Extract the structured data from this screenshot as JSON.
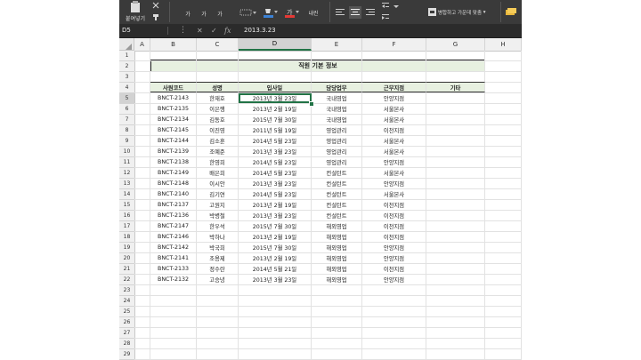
{
  "ribbon": {
    "paste_label": "붙여넣기",
    "font_bold": "가",
    "font_italic": "가",
    "font_underline": "가",
    "wrap_label": "내린",
    "merge_label": "병합하고 가운데 맞춤",
    "merge_arrow": "▾"
  },
  "formula_bar": {
    "cell_ref": "D5",
    "fx": "fx",
    "value": "2013.3.23"
  },
  "columns": [
    "A",
    "B",
    "C",
    "D",
    "E",
    "F",
    "G",
    "H"
  ],
  "rows": [
    "1",
    "2",
    "3",
    "4",
    "5",
    "6",
    "7",
    "8",
    "9",
    "10",
    "11",
    "12",
    "13",
    "14",
    "15",
    "16",
    "17",
    "18",
    "19",
    "20",
    "21",
    "22",
    "23",
    "24",
    "25",
    "26",
    "27",
    "28",
    "29"
  ],
  "sheet": {
    "title": "직원 기본 정보",
    "headers": [
      "사원코드",
      "성명",
      "입사일",
      "담당업무",
      "근무지점",
      "기타"
    ],
    "records": [
      [
        "BNCT-2143",
        "한재호",
        "2013년 3월 23일",
        "국내영업",
        "안양지점",
        ""
      ],
      [
        "BNCT-2135",
        "이은행",
        "2013년 2월 19일",
        "국내영업",
        "서울본사",
        ""
      ],
      [
        "BNCT-2134",
        "김동호",
        "2015년 7월 30일",
        "국내영업",
        "서울본사",
        ""
      ],
      [
        "BNCT-2145",
        "이진영",
        "2011년 5월 19일",
        "영업관리",
        "이천지점",
        ""
      ],
      [
        "BNCT-2144",
        "김소훈",
        "2014년 5월 23일",
        "영업관리",
        "서울본사",
        ""
      ],
      [
        "BNCT-2139",
        "조예준",
        "2013년 3월 23일",
        "영업관리",
        "서울본사",
        ""
      ],
      [
        "BNCT-2138",
        "한영희",
        "2014년 5월 23일",
        "영업관리",
        "안양지점",
        ""
      ],
      [
        "BNCT-2149",
        "배은희",
        "2014년 5월 23일",
        "컨설턴트",
        "서울본사",
        ""
      ],
      [
        "BNCT-2148",
        "이시안",
        "2013년 3월 23일",
        "컨설턴트",
        "안양지점",
        ""
      ],
      [
        "BNCT-2140",
        "김기연",
        "2014년 5월 23일",
        "컨설턴트",
        "서울본사",
        ""
      ],
      [
        "BNCT-2137",
        "고원지",
        "2013년 2월 19일",
        "컨설턴트",
        "이천지점",
        ""
      ],
      [
        "BNCT-2136",
        "박병철",
        "2013년 3월 23일",
        "컨설턴트",
        "이천지점",
        ""
      ],
      [
        "BNCT-2147",
        "한우석",
        "2015년 7월 30일",
        "해외영업",
        "이천지점",
        ""
      ],
      [
        "BNCT-2146",
        "박하나",
        "2013년 2월 19일",
        "해외영업",
        "이천지점",
        ""
      ],
      [
        "BNCT-2142",
        "박국희",
        "2015년 7월 30일",
        "해외영업",
        "안양지점",
        ""
      ],
      [
        "BNCT-2141",
        "조용제",
        "2013년 2월 19일",
        "해외영업",
        "안양지점",
        ""
      ],
      [
        "BNCT-2133",
        "정수란",
        "2014년 5월 21일",
        "해외영업",
        "이천지점",
        ""
      ],
      [
        "BNCT-2132",
        "고승녕",
        "2013년 3월 23일",
        "해외영업",
        "안양지점",
        ""
      ]
    ]
  },
  "selected_cell": "D5",
  "colors": {
    "header_fill": "#e7f0e0",
    "selection": "#217346",
    "ribbon_bg": "#3a3a3a"
  }
}
